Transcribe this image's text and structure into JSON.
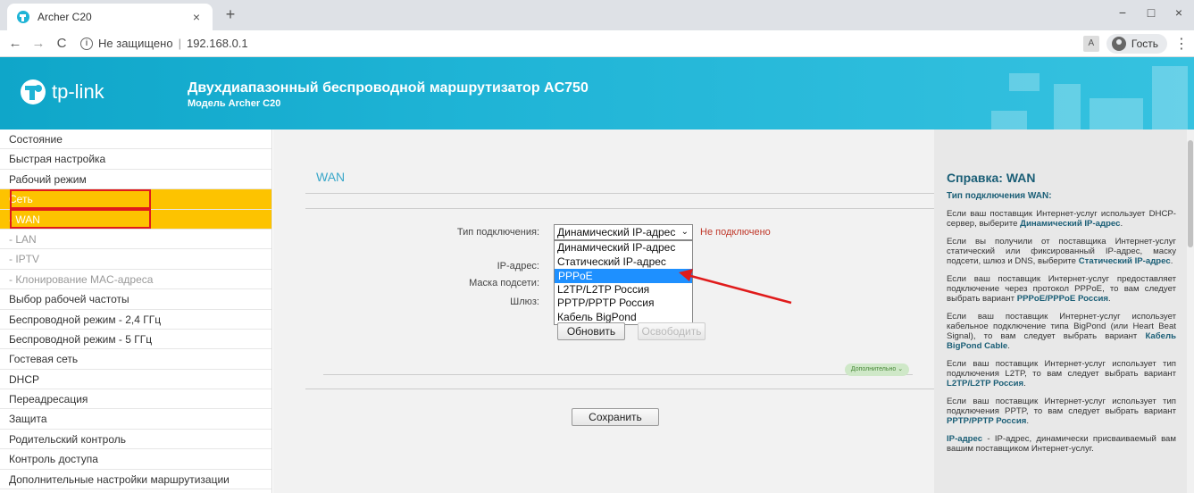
{
  "browser": {
    "tab_title": "Archer C20",
    "tab_close": "×",
    "new_tab": "+",
    "back": "←",
    "forward": "→",
    "reload": "C",
    "security_label": "Не защищено",
    "separator": "|",
    "url": "192.168.0.1",
    "translate": "A",
    "profile_label": "Гость",
    "menu": "⋮",
    "minimize": "−",
    "restore": "□",
    "close": "×"
  },
  "header": {
    "logo_text": "tp-link",
    "title": "Двухдиапазонный беспроводной маршрутизатор AC750",
    "model": "Модель Archer C20"
  },
  "sidebar": {
    "items": [
      {
        "label": "Состояние",
        "sub": false,
        "active": false
      },
      {
        "label": "Быстрая настройка",
        "sub": false,
        "active": false
      },
      {
        "label": "Рабочий режим",
        "sub": false,
        "active": false
      },
      {
        "label": "Сеть",
        "sub": false,
        "active": true
      },
      {
        "label": "- WAN",
        "sub": true,
        "active": true
      },
      {
        "label": "- LAN",
        "sub": true,
        "active": false
      },
      {
        "label": "- IPTV",
        "sub": true,
        "active": false
      },
      {
        "label": "- Клонирование MAC-адреса",
        "sub": true,
        "active": false
      },
      {
        "label": "Выбор рабочей частоты",
        "sub": false,
        "active": false
      },
      {
        "label": "Беспроводной режим - 2,4 ГГц",
        "sub": false,
        "active": false
      },
      {
        "label": "Беспроводной режим - 5 ГГц",
        "sub": false,
        "active": false
      },
      {
        "label": "Гостевая сеть",
        "sub": false,
        "active": false
      },
      {
        "label": "DHCP",
        "sub": false,
        "active": false
      },
      {
        "label": "Переадресация",
        "sub": false,
        "active": false
      },
      {
        "label": "Защита",
        "sub": false,
        "active": false
      },
      {
        "label": "Родительский контроль",
        "sub": false,
        "active": false
      },
      {
        "label": "Контроль доступа",
        "sub": false,
        "active": false
      },
      {
        "label": "Дополнительные настройки маршрутизации",
        "sub": false,
        "active": false
      }
    ]
  },
  "main": {
    "title": "WAN",
    "connection_type_label": "Тип подключения:",
    "selected_type": "Динамический IP-адрес",
    "select_arrow": "⌄",
    "status": "Не подключено",
    "ip_label": "IP-адрес:",
    "mask_label": "Маска подсети:",
    "gateway_label": "Шлюз:",
    "options": [
      "Динамический IP-адрес",
      "Статический IP-адрес",
      "PPPoE",
      "L2TP/L2TP Россия",
      "PPTP/PPTP Россия",
      "Кабель BigPond"
    ],
    "highlighted_option_index": 2,
    "renew_button": "Обновить",
    "release_button": "Освободить",
    "advanced_link": "Дополнительно ⌄",
    "save_button": "Сохранить"
  },
  "help": {
    "title": "Справка: WAN",
    "subtitle": "Тип подключения WAN:",
    "p1_text": "Если ваш поставщик Интернет-услуг использует DHCP-сервер, выберите ",
    "p1_bold": "Динамический IP-адрес",
    "p1_end": ".",
    "p2_text": "Если вы получили от поставщика Интернет-услуг статический или фиксированный IP-адрес, маску подсети, шлюз и DNS, выберите ",
    "p2_bold": "Статический IP-адрес",
    "p2_end": ".",
    "p3_text": "Если ваш поставщик Интернет-услуг предоставляет подключение через протокол PPPoE, то вам следует выбрать вариант ",
    "p3_bold": "PPPoE/PPPoE Россия",
    "p3_end": ".",
    "p4_text": "Если ваш поставщик Интернет-услуг использует кабельное подключение типа BigPond (или Heart Beat Signal), то вам следует выбрать вариант ",
    "p4_bold": "Кабель BigPond Cable",
    "p4_end": ".",
    "p5_text": "Если ваш поставщик Интернет-услуг использует тип подключения L2TP, то вам следует выбрать вариант ",
    "p5_bold": "L2TP/L2TP Россия",
    "p5_end": ".",
    "p6_text": "Если ваш поставщик Интернет-услуг использует тип подключения PPTP, то вам следует выбрать вариант ",
    "p6_bold": "PPTP/PPTP Россия",
    "p6_end": ".",
    "p7_bold": "IP-адрес",
    "p7_text": " - IP-адрес, динамически присваиваемый вам вашим поставщиком Интернет-услуг."
  },
  "colors": {
    "header": "#1fb4d6",
    "active_menu": "#fdc300",
    "highlight_box": "#e01b1b",
    "dropdown_selected": "#1e90ff",
    "status_text": "#c0392b"
  }
}
